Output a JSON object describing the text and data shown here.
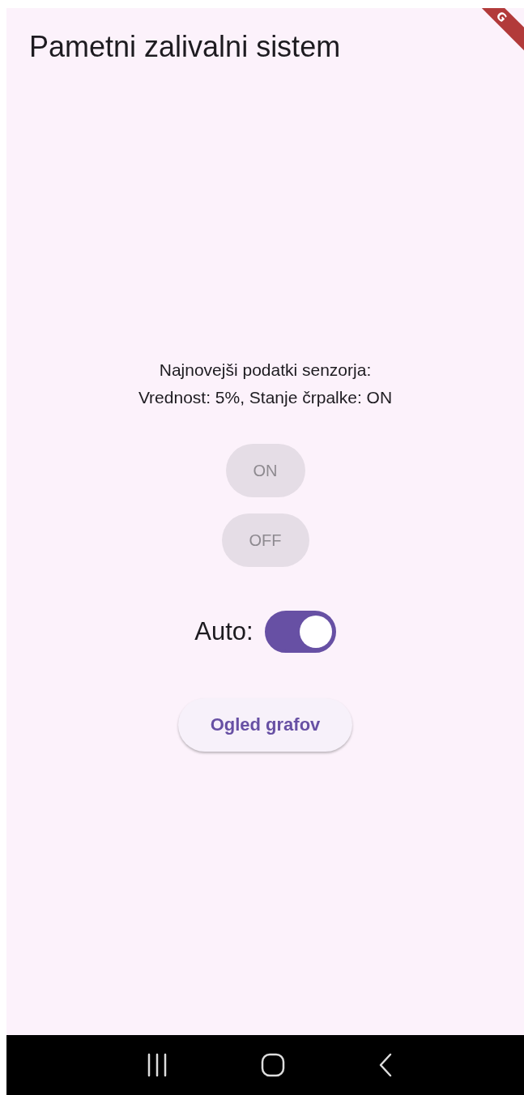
{
  "app_bar": {
    "title": "Pametni zalivalni sistem"
  },
  "debug_banner": {
    "text": "G"
  },
  "sensor": {
    "heading": "Najnovejši podatki senzorja:",
    "reading": "Vrednost: 5%, Stanje črpalke: ON"
  },
  "pump_buttons": [
    {
      "label": "ON",
      "disabled": true
    },
    {
      "label": "OFF",
      "disabled": true
    }
  ],
  "auto": {
    "label": "Auto:",
    "on": true
  },
  "charts_button": {
    "label": "Ogled grafov"
  }
}
